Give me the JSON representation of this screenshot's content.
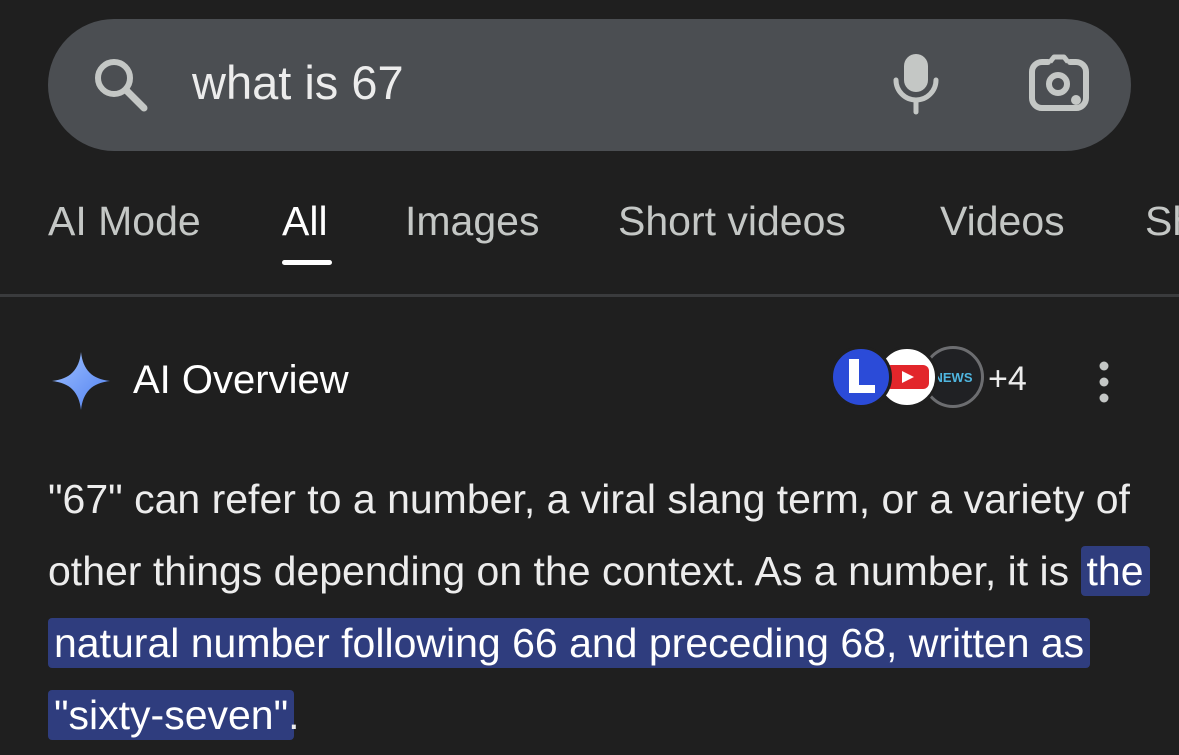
{
  "search": {
    "query": "what is 67"
  },
  "icons": {
    "search": "search-icon",
    "microphone": "microphone-icon",
    "lens": "google-lens-icon",
    "sparkle": "ai-sparkle-icon",
    "more": "more-vert-icon"
  },
  "tabs": [
    {
      "label": "AI Mode",
      "active": false
    },
    {
      "label": "All",
      "active": true
    },
    {
      "label": "Images",
      "active": false
    },
    {
      "label": "Short videos",
      "active": false
    },
    {
      "label": "Videos",
      "active": false
    },
    {
      "label": "Sh",
      "active": false
    }
  ],
  "ai_overview": {
    "title": "AI Overview",
    "sources_badge_text": "NEWS",
    "sources_more": "+4",
    "text_part1": "\"67\" can refer to a number, a viral slang term, or a variety of other things depending on the context. As a number, it is ",
    "text_highlight": "the natural number following 66 and preceding 68, written as \"sixty-seven\"",
    "text_part2": "."
  },
  "colors": {
    "background": "#1f1f1f",
    "search_bar": "#4b4e52",
    "highlight": "#2f3d7e",
    "sparkle": "#8ab4f8"
  }
}
